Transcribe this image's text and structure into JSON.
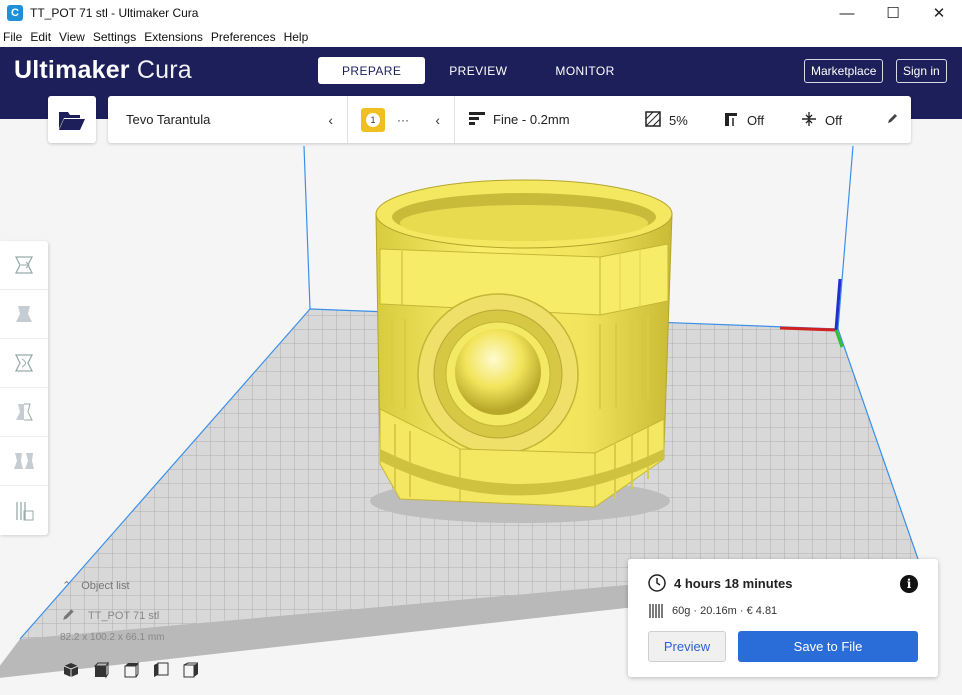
{
  "window": {
    "title": "TT_POT 71 stl - Ultimaker Cura",
    "app_icon": "C",
    "minimize": "—",
    "maximize": "☐",
    "close": "✕"
  },
  "menu": [
    "File",
    "Edit",
    "View",
    "Settings",
    "Extensions",
    "Preferences",
    "Help"
  ],
  "header": {
    "logo_a": "Ultimaker",
    "logo_b": "Cura",
    "tabs": [
      {
        "label": "PREPARE",
        "active": true
      },
      {
        "label": "PREVIEW",
        "active": false
      },
      {
        "label": "MONITOR",
        "active": false
      }
    ],
    "marketplace": "Marketplace",
    "sign_in": "Sign in"
  },
  "config": {
    "printer": "Tevo Tarantula",
    "extruder_number": "1",
    "extruder_dots": "···",
    "profile": "Fine - 0.2mm",
    "infill": "5%",
    "support": "Off",
    "adhesion": "Off"
  },
  "object_list": {
    "title": "Object list",
    "item": "TT_POT 71 stl",
    "dimensions": "82.2 x 100.2 x 66.1 mm"
  },
  "print": {
    "time": "4 hours 18 minutes",
    "material": "60g · 20.16m · € 4.81",
    "preview_label": "Preview",
    "save_label": "Save to File",
    "info_label": "i"
  },
  "colors": {
    "header": "#1c1f5a",
    "accent": "#2a6dd8",
    "model": "#f8ee6a"
  }
}
